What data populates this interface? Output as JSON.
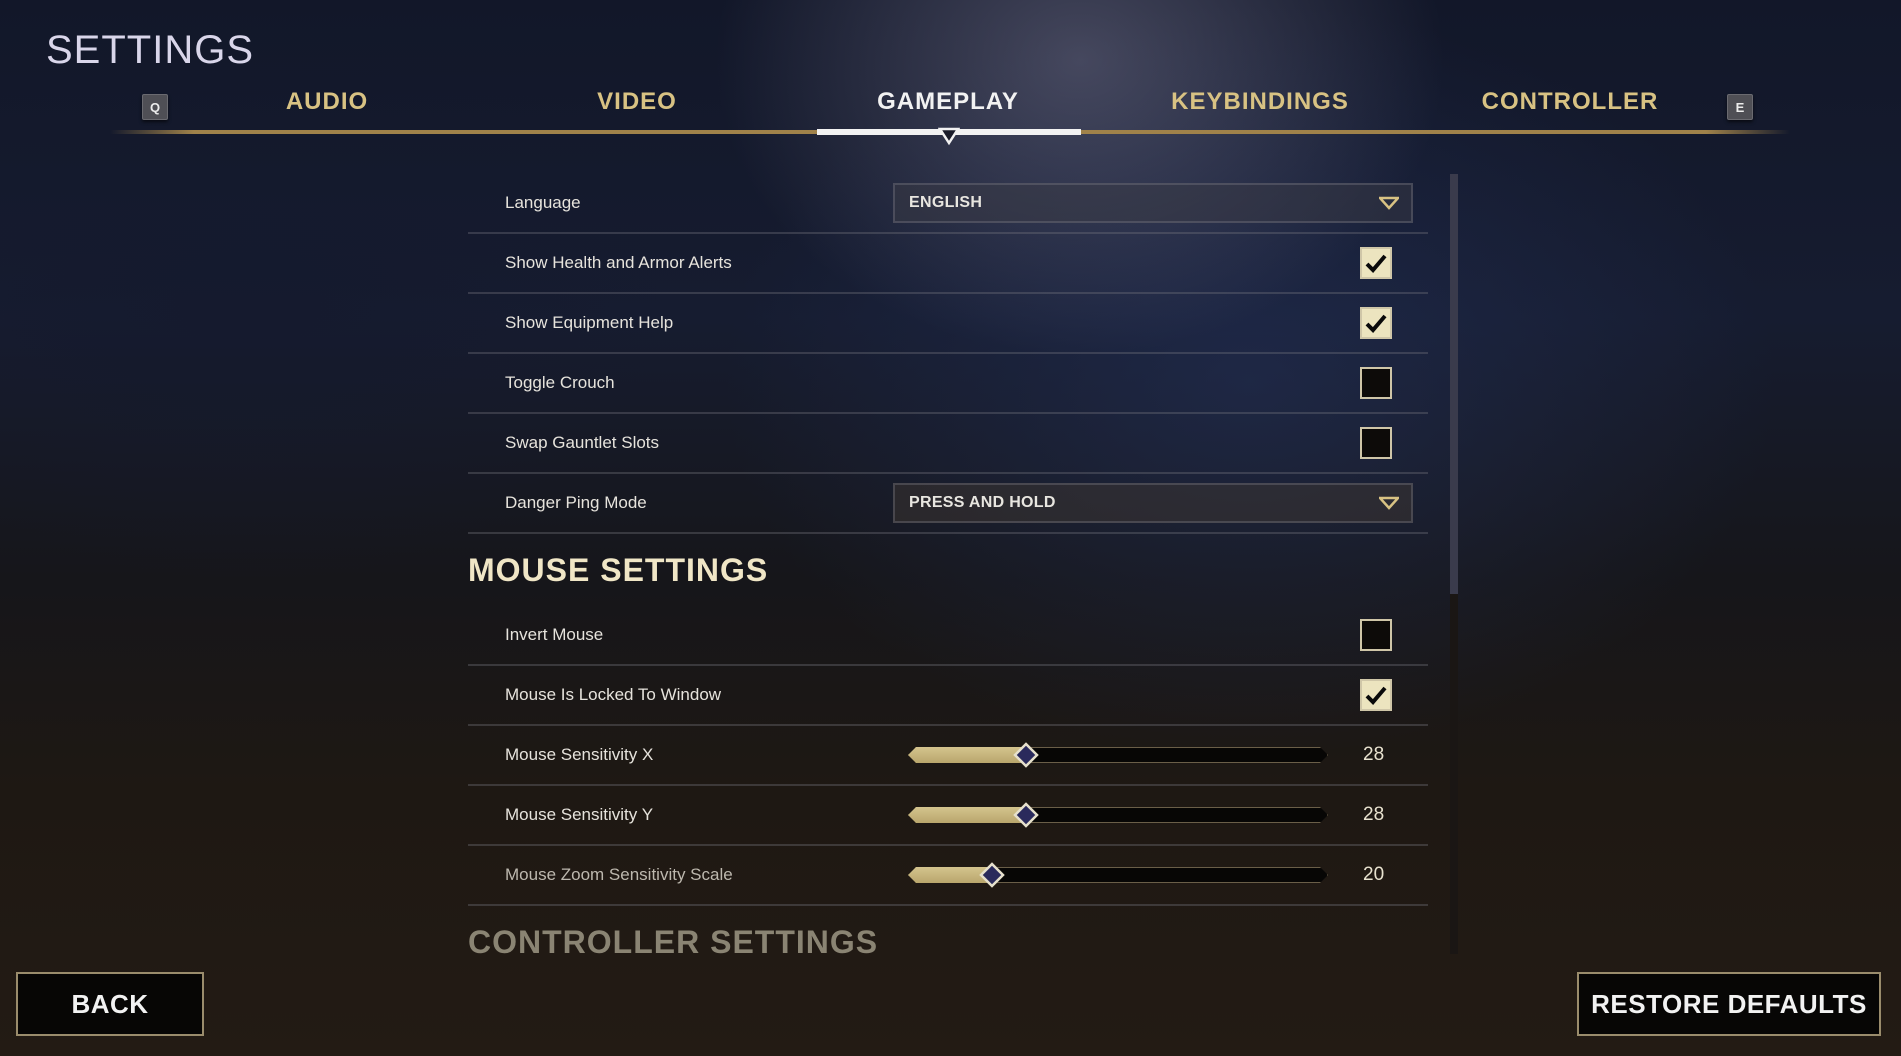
{
  "header": {
    "title": "SETTINGS"
  },
  "tabs": {
    "prev_key": "Q",
    "next_key": "E",
    "items": [
      {
        "label": "AUDIO",
        "active": false
      },
      {
        "label": "VIDEO",
        "active": false
      },
      {
        "label": "GAMEPLAY",
        "active": true
      },
      {
        "label": "KEYBINDINGS",
        "active": false
      },
      {
        "label": "CONTROLLER",
        "active": false
      }
    ]
  },
  "gameplay": {
    "language": {
      "label": "Language",
      "value": "ENGLISH"
    },
    "health_alerts": {
      "label": "Show Health and Armor Alerts",
      "checked": true
    },
    "equipment_help": {
      "label": "Show Equipment Help",
      "checked": true
    },
    "toggle_crouch": {
      "label": "Toggle Crouch",
      "checked": false
    },
    "swap_gauntlet": {
      "label": "Swap Gauntlet Slots",
      "checked": false
    },
    "danger_ping": {
      "label": "Danger Ping Mode",
      "value": "PRESS AND HOLD"
    }
  },
  "mouse": {
    "heading": "MOUSE SETTINGS",
    "invert": {
      "label": "Invert Mouse",
      "checked": false
    },
    "locked": {
      "label": "Mouse Is Locked To Window",
      "checked": true
    },
    "sens_x": {
      "label": "Mouse Sensitivity X",
      "value": "28",
      "fraction": 0.28
    },
    "sens_y": {
      "label": "Mouse Sensitivity Y",
      "value": "28",
      "fraction": 0.28
    },
    "zoom_scale": {
      "label": "Mouse Zoom Sensitivity Scale",
      "value": "20",
      "fraction": 0.2
    }
  },
  "controller": {
    "heading": "CONTROLLER SETTINGS"
  },
  "footer": {
    "back_label": "BACK",
    "restore_label": "RESTORE DEFAULTS"
  },
  "colors": {
    "accent_gold": "#d8c283",
    "line_gold": "#a0824a",
    "checkbox_on": "#ece4bf",
    "slider_thumb": "#2a2a5c"
  }
}
